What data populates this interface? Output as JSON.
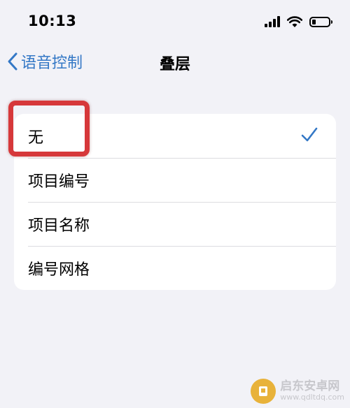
{
  "status_bar": {
    "time": "10:13",
    "icons": [
      "cellular-signal-icon",
      "wifi-icon",
      "battery-icon"
    ]
  },
  "nav": {
    "back_label": "语音控制",
    "title": "叠层"
  },
  "list": {
    "items": [
      {
        "label": "无",
        "selected": true
      },
      {
        "label": "项目编号",
        "selected": false
      },
      {
        "label": "项目名称",
        "selected": false
      },
      {
        "label": "编号网格",
        "selected": false
      }
    ]
  },
  "colors": {
    "accent": "#3478c6",
    "background": "#f2f2f7",
    "highlight": "#d6383a"
  },
  "watermark": {
    "name": "启东安卓网",
    "url": "www.qdltdq.com"
  }
}
